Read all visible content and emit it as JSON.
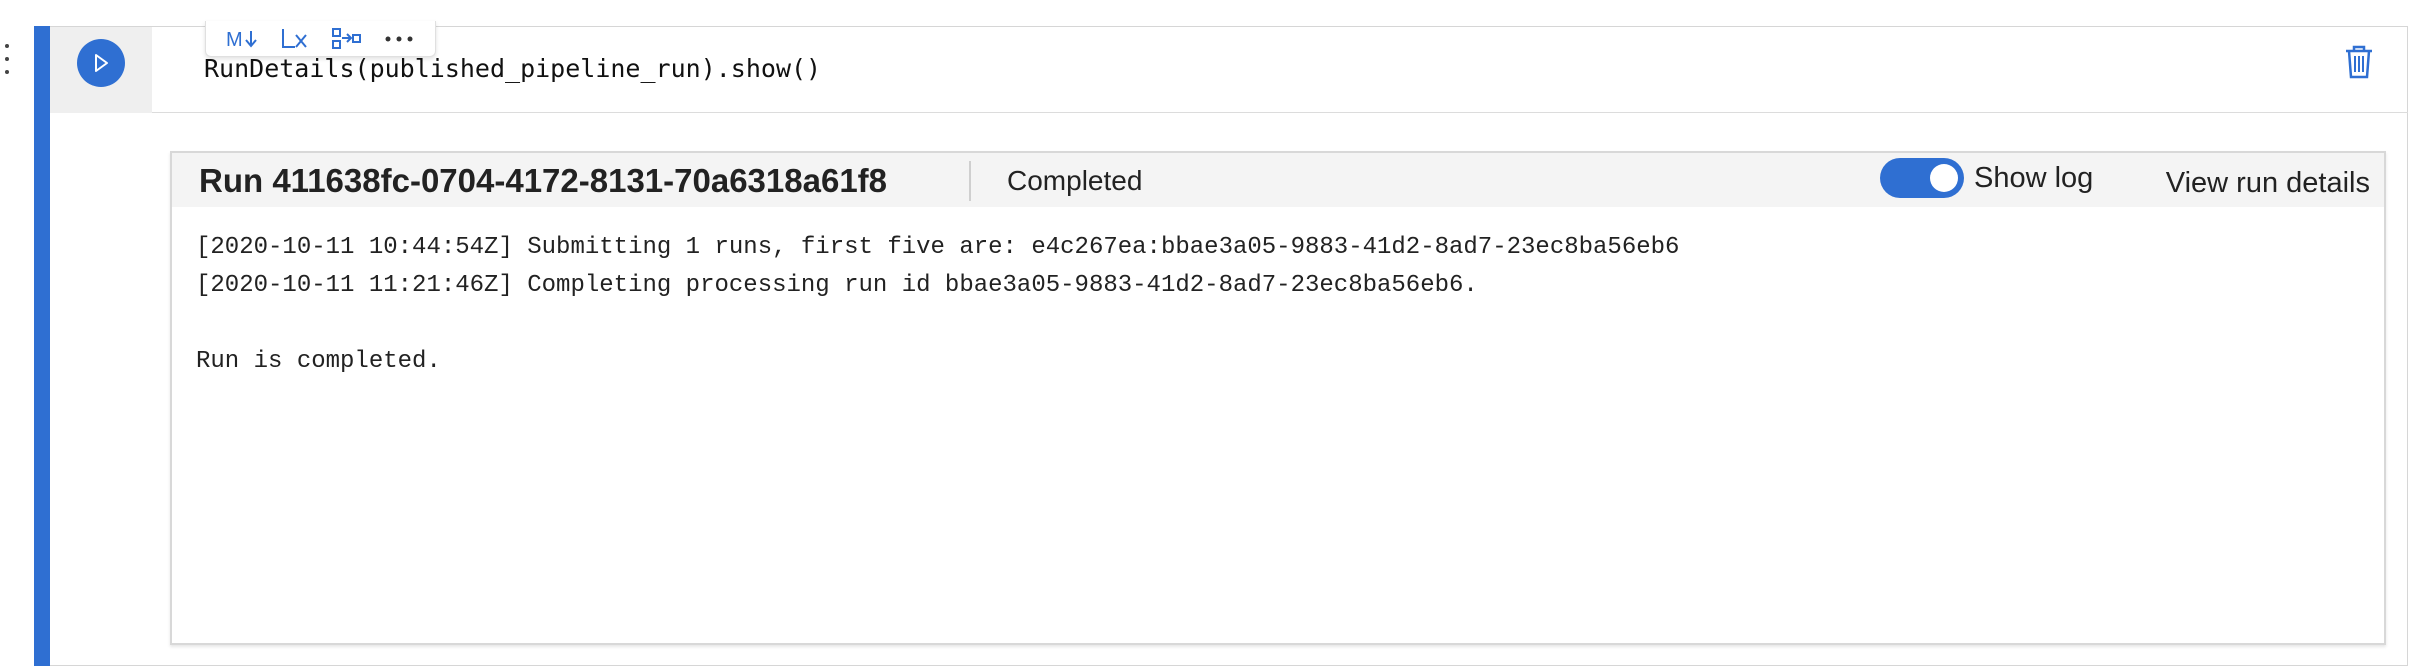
{
  "cell": {
    "code": "RunDetails(published_pipeline_run).show()",
    "accent_color": "#2f6fd2",
    "toolbar": {
      "icons": [
        "markdown-toggle-icon",
        "clear-output-icon",
        "split-cell-icon",
        "more-icon"
      ]
    }
  },
  "widget": {
    "run_title": "Run 411638fc-0704-4172-8131-70a6318a61f8",
    "status": "Completed",
    "show_log_label": "Show log",
    "show_log_enabled": true,
    "view_details_label": "View run details",
    "log_lines": [
      "[2020-10-11 10:44:54Z] Submitting 1 runs, first five are: e4c267ea:bbae3a05-9883-41d2-8ad7-23ec8ba56eb6",
      "[2020-10-11 11:21:46Z] Completing processing run id bbae3a05-9883-41d2-8ad7-23ec8ba56eb6.",
      "",
      "Run is completed."
    ]
  }
}
